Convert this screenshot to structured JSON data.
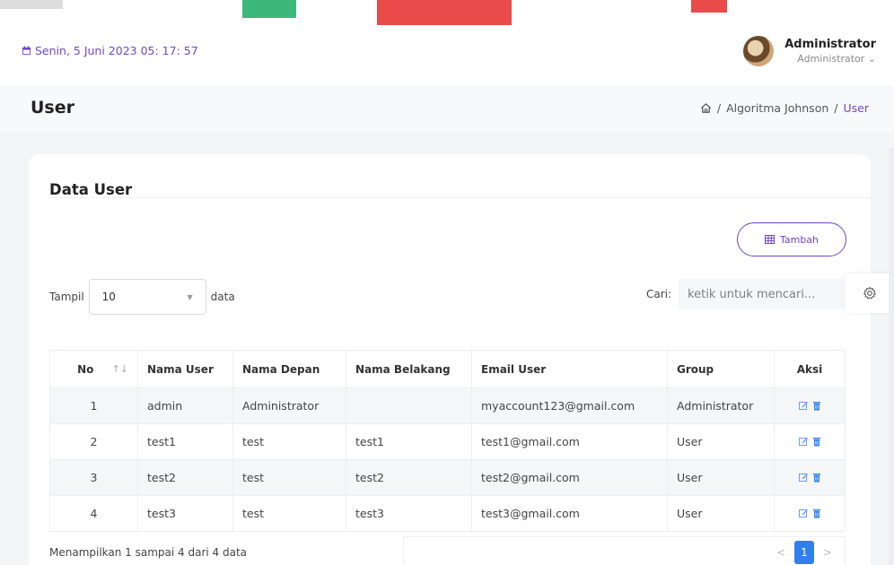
{
  "header": {
    "date": "Senin, 5 Juni 2023  05: 17: 57",
    "user_name": "Administrator",
    "user_role": "Administrator",
    "role_caret": "⌄"
  },
  "page": {
    "title": "User",
    "breadcrumb": [
      "Algoritma Johnson",
      "User"
    ],
    "breadcrumb_sep": "/"
  },
  "card": {
    "title": "Data User",
    "add_label": "Tambah",
    "show_label": "Tampil",
    "show_value": "10",
    "show_suffix": "data",
    "search_label": "Cari:",
    "search_placeholder": "ketik untuk mencari..."
  },
  "table": {
    "columns": [
      "No",
      "Nama User",
      "Nama Depan",
      "Nama Belakang",
      "Email User",
      "Group",
      "Aksi"
    ],
    "sort_indicator": "↑↓",
    "rows": [
      {
        "no": "1",
        "user": "admin",
        "first": "Administrator",
        "last": "",
        "email": "myaccount123@gmail.com",
        "group": "Administrator"
      },
      {
        "no": "2",
        "user": "test1",
        "first": "test",
        "last": "test1",
        "email": "test1@gmail.com",
        "group": "User"
      },
      {
        "no": "3",
        "user": "test2",
        "first": "test",
        "last": "test2",
        "email": "test2@gmail.com",
        "group": "User"
      },
      {
        "no": "4",
        "user": "test3",
        "first": "test",
        "last": "test3",
        "email": "test3@gmail.com",
        "group": "User"
      }
    ]
  },
  "footer": {
    "info": "Menampilkan 1 sampai 4 dari 4 data",
    "prev": "<",
    "page": "1",
    "next": ">"
  },
  "colors": {
    "accent": "#6f47c7",
    "page_active": "#2f80ed",
    "edit_icon": "#6f9cf0",
    "delete_icon": "#2f80ed"
  },
  "icons": [
    "calendar-icon",
    "home-icon",
    "table-icon",
    "gear-icon",
    "edit-icon",
    "delete-icon"
  ]
}
